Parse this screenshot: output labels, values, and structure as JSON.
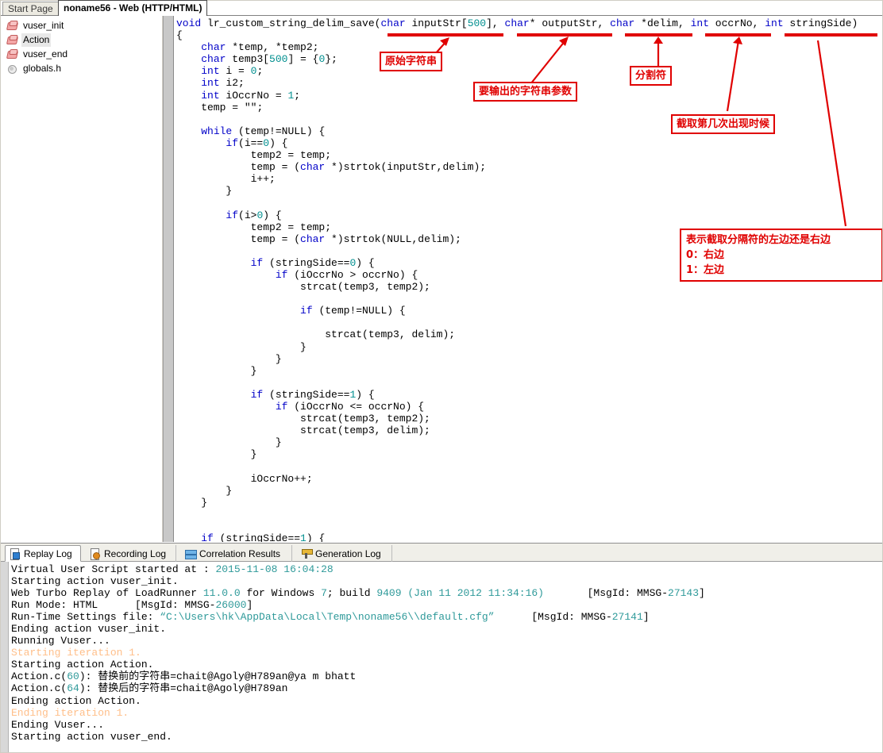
{
  "window": {
    "title": "noname56 - Web (HTTP/HTML)"
  },
  "doc_tabs": [
    {
      "label": "Start Page",
      "active": false
    },
    {
      "label": "noname56 - Web (HTTP/HTML)",
      "active": true
    }
  ],
  "tree": {
    "items": [
      {
        "label": "vuser_init",
        "icon": "action-block-icon",
        "selected": false
      },
      {
        "label": "Action",
        "icon": "action-block-icon",
        "selected": true
      },
      {
        "label": "vuser_end",
        "icon": "action-block-icon",
        "selected": false
      },
      {
        "label": "globals.h",
        "icon": "header-file-icon",
        "selected": false
      }
    ]
  },
  "editor": {
    "language": "c",
    "code_lines": [
      "void lr_custom_string_delim_save(char inputStr[500], char* outputStr, char *delim, int occrNo, int stringSide)",
      "{",
      "    char *temp, *temp2;",
      "    char temp3[500] = {0};",
      "    int i = 0;",
      "    int i2;",
      "    int iOccrNo = 1;",
      "    temp = \"\";",
      "",
      "    while (temp!=NULL) {",
      "        if(i==0) {",
      "            temp2 = temp;",
      "            temp = (char *)strtok(inputStr,delim);",
      "            i++;",
      "        }",
      "",
      "        if(i>0) {",
      "            temp2 = temp;",
      "            temp = (char *)strtok(NULL,delim);",
      "",
      "            if (stringSide==0) {",
      "                if (iOccrNo > occrNo) {",
      "                    strcat(temp3, temp2);",
      "",
      "                    if (temp!=NULL) {",
      "",
      "                        strcat(temp3, delim);",
      "                    }",
      "                }",
      "            }",
      "",
      "            if (stringSide==1) {",
      "                if (iOccrNo <= occrNo) {",
      "                    strcat(temp3, temp2);",
      "                    strcat(temp3, delim);",
      "                }",
      "            }",
      "",
      "            iOccrNo++;",
      "        }",
      "    }",
      "",
      "",
      "    if (stringSide==1) {"
    ]
  },
  "annotations": [
    {
      "name": "original-string",
      "text": "原始字符串"
    },
    {
      "name": "output-string-param",
      "text": "要输出的字符串参数"
    },
    {
      "name": "delimiter",
      "text": "分割符"
    },
    {
      "name": "occurrence-number",
      "text": "截取第几次出现时候"
    },
    {
      "name": "string-side",
      "text": "表示截取分隔符的左边还是右边\n0：右边\n1：左边"
    }
  ],
  "log_tabs": [
    {
      "label": "Replay Log",
      "icon": "replay-log-icon",
      "active": true
    },
    {
      "label": "Recording Log",
      "icon": "recording-log-icon",
      "active": false
    },
    {
      "label": "Correlation Results",
      "icon": "correlation-results-icon",
      "active": false
    },
    {
      "label": "Generation Log",
      "icon": "generation-log-icon",
      "active": false
    }
  ],
  "log": {
    "lines": [
      "Virtual User Script started at : 2015-11-08 16:04:28",
      "Starting action vuser_init.",
      "Web Turbo Replay of LoadRunner 11.0.0 for Windows 7; build 9409 (Jan 11 2012 11:34:16)       [MsgId: MMSG-27143]",
      "Run Mode: HTML      [MsgId: MMSG-26000]",
      "Run-Time Settings file: “C:\\Users\\hk\\AppData\\Local\\Temp\\noname56\\\\default.cfg”      [MsgId: MMSG-27141]",
      "Ending action vuser_init.",
      "Running Vuser...",
      "Starting iteration 1.",
      "Starting action Action.",
      "Action.c(60): 替换前的字符串=chait@Agoly@H789an@ya m bhatt",
      "Action.c(64): 替换后的字符串=chait@Agoly@H789an",
      "Ending action Action.",
      "Ending iteration 1.",
      "Ending Vuser...",
      "Starting action vuser_end."
    ]
  },
  "colors": {
    "keyword": "#0000c8",
    "number": "#008f8f",
    "annotation_red": "#e00000",
    "log_teal": "#2f9a9a",
    "log_iteration": "#ffbf8a"
  }
}
